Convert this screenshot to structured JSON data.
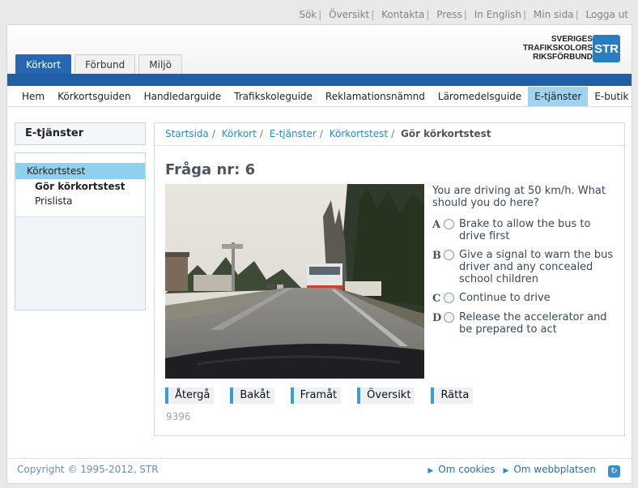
{
  "top_links": [
    "Sök",
    "Översikt",
    "Kontakta",
    "Press",
    "In English",
    "Min sida",
    "Logga ut"
  ],
  "logo": {
    "line1": "SVERIGES",
    "line2": "TRAFIKSKOLORS",
    "line3": "RIKSFÖRBUND",
    "badge": "STR"
  },
  "tabs": [
    {
      "label": "Körkort",
      "active": true
    },
    {
      "label": "Förbund",
      "active": false
    },
    {
      "label": "Miljö",
      "active": false
    }
  ],
  "main_nav": [
    "Hem",
    "Körkortsguiden",
    "Handledarguide",
    "Trafikskoleguide",
    "Reklamationsnämnd",
    "Läromedelsguide",
    "E-tjänster",
    "E-butik"
  ],
  "main_nav_active": "E-tjänster",
  "sidebar": {
    "title": "E-tjänster",
    "category": "Körkortstest",
    "items": [
      {
        "label": "Gör körkortstest",
        "bold": true
      },
      {
        "label": "Prislista",
        "bold": false
      }
    ]
  },
  "breadcrumb": {
    "links": [
      "Startsida",
      "Körkort",
      "E-tjänster",
      "Körkortstest"
    ],
    "current": "Gör körkortstest"
  },
  "quiz": {
    "title": "Fråga nr: 6",
    "question": "You are driving at 50 km/h. What should you do here?",
    "answers": [
      {
        "letter": "A",
        "text": "Brake to allow the bus to drive first"
      },
      {
        "letter": "B",
        "text": "Give a signal to warn the bus driver and any concealed school children"
      },
      {
        "letter": "C",
        "text": "Continue to drive"
      },
      {
        "letter": "D",
        "text": "Release the accelerator and be prepared to act"
      }
    ],
    "buttons": [
      "Återgå",
      "Bakåt",
      "Framåt",
      "Översikt",
      "Rätta"
    ],
    "question_id": "9396"
  },
  "footer": {
    "copyright": "Copyright © 1995-2012, STR",
    "links": [
      "Om cookies",
      "Om webbplatsen"
    ]
  },
  "colors": {
    "brand_blue": "#1f5fa5",
    "active_nav": "#9fd3ef",
    "link": "#2a8ac4"
  }
}
